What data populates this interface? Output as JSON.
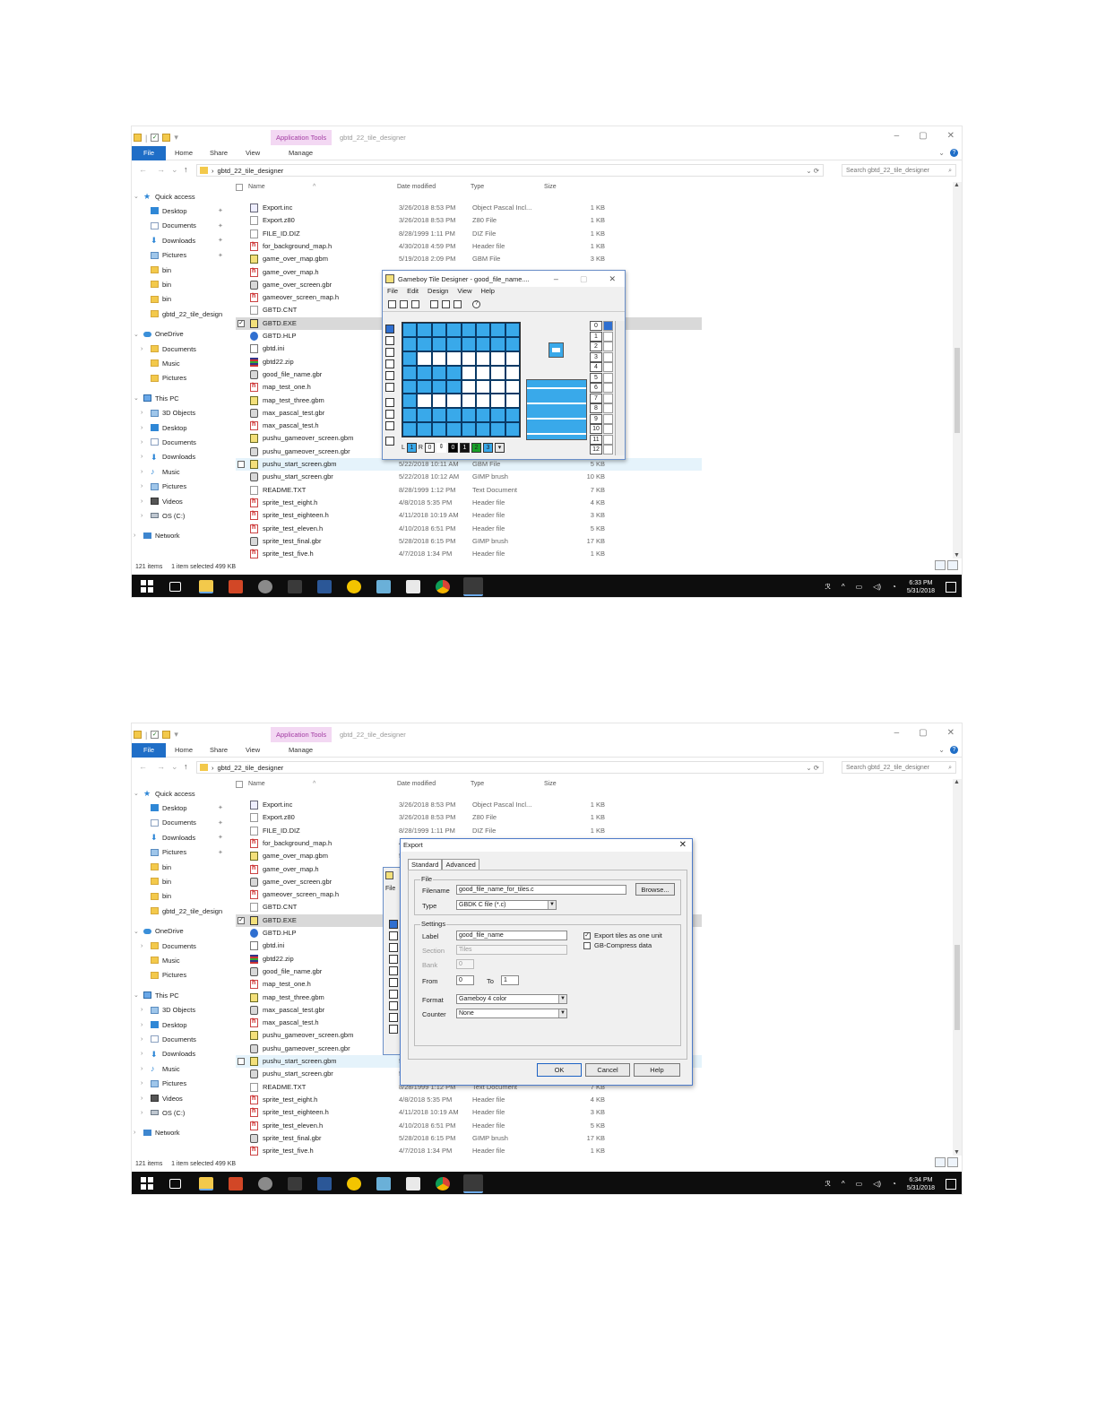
{
  "explorer": {
    "app_tools": "Application Tools",
    "window_title": "gbtd_22_tile_designer",
    "ribbon_tabs": [
      "File",
      "Home",
      "Share",
      "View",
      "Manage"
    ],
    "address": "gbtd_22_tile_designer",
    "search_placeholder": "Search gbtd_22_tile_designer",
    "columns": {
      "name": "Name",
      "date": "Date modified",
      "type": "Type",
      "size": "Size"
    },
    "nav": [
      {
        "label": "Quick access",
        "icon": "star-icon",
        "indent": 0,
        "chev": "⌄",
        "pin": false
      },
      {
        "label": "Desktop",
        "icon": "desktop-icon",
        "indent": 1,
        "chev": "",
        "pin": true
      },
      {
        "label": "Documents",
        "icon": "documents-icon",
        "indent": 1,
        "chev": "",
        "pin": true
      },
      {
        "label": "Downloads",
        "icon": "downloads-icon",
        "indent": 1,
        "chev": "",
        "pin": true
      },
      {
        "label": "Pictures",
        "icon": "pictures-icon",
        "indent": 1,
        "chev": "",
        "pin": true
      },
      {
        "label": "bin",
        "icon": "folder-icon",
        "indent": 1,
        "chev": "",
        "pin": false
      },
      {
        "label": "bin",
        "icon": "folder-icon",
        "indent": 1,
        "chev": "",
        "pin": false
      },
      {
        "label": "bin",
        "icon": "folder-icon",
        "indent": 1,
        "chev": "",
        "pin": false
      },
      {
        "label": "gbtd_22_tile_design",
        "icon": "folder-icon",
        "indent": 1,
        "chev": "",
        "pin": false
      },
      {
        "label": "OneDrive",
        "icon": "cloud-icon",
        "indent": 0,
        "chev": "⌄",
        "pin": false
      },
      {
        "label": "Documents",
        "icon": "folder-icon",
        "indent": 1,
        "chev": "›",
        "pin": false
      },
      {
        "label": "Music",
        "icon": "folder-icon",
        "indent": 1,
        "chev": "",
        "pin": false
      },
      {
        "label": "Pictures",
        "icon": "folder-icon",
        "indent": 1,
        "chev": "",
        "pin": false
      },
      {
        "label": "This PC",
        "icon": "pc-icon",
        "indent": 0,
        "chev": "⌄",
        "pin": false
      },
      {
        "label": "3D Objects",
        "icon": "objects-3d-icon",
        "indent": 1,
        "chev": "›",
        "pin": false
      },
      {
        "label": "Desktop",
        "icon": "desktop-icon",
        "indent": 1,
        "chev": "›",
        "pin": false
      },
      {
        "label": "Documents",
        "icon": "documents-icon",
        "indent": 1,
        "chev": "›",
        "pin": false
      },
      {
        "label": "Downloads",
        "icon": "downloads-icon",
        "indent": 1,
        "chev": "›",
        "pin": false
      },
      {
        "label": "Music",
        "icon": "music-icon",
        "indent": 1,
        "chev": "›",
        "pin": false
      },
      {
        "label": "Pictures",
        "icon": "pictures-icon",
        "indent": 1,
        "chev": "›",
        "pin": false
      },
      {
        "label": "Videos",
        "icon": "videos-icon",
        "indent": 1,
        "chev": "›",
        "pin": false
      },
      {
        "label": "OS (C:)",
        "icon": "drive-icon",
        "indent": 1,
        "chev": "›",
        "pin": false
      },
      {
        "label": "Network",
        "icon": "network-icon",
        "indent": 0,
        "chev": "›",
        "pin": false
      }
    ],
    "files": [
      {
        "name": "Export.inc",
        "date": "3/26/2018 8:53 PM",
        "type": "Object Pascal Incl...",
        "size": "1 KB",
        "icon": "inc"
      },
      {
        "name": "Export.z80",
        "date": "3/26/2018 8:53 PM",
        "type": "Z80 File",
        "size": "1 KB",
        "icon": "txt"
      },
      {
        "name": "FILE_ID.DIZ",
        "date": "8/28/1999 1:11 PM",
        "type": "DIZ File",
        "size": "1 KB",
        "icon": "txt"
      },
      {
        "name": "for_background_map.h",
        "date": "4/30/2018 4:59 PM",
        "type": "Header file",
        "size": "1 KB",
        "icon": "h"
      },
      {
        "name": "game_over_map.gbm",
        "date": "5/19/2018 2:09 PM",
        "type": "GBM File",
        "size": "3 KB",
        "icon": "gbm"
      },
      {
        "name": "game_over_map.h",
        "date": "",
        "type": "",
        "size": "",
        "icon": "h"
      },
      {
        "name": "game_over_screen.gbr",
        "date": "",
        "type": "",
        "size": "",
        "icon": "gbr"
      },
      {
        "name": "gameover_screen_map.h",
        "date": "",
        "type": "",
        "size": "",
        "icon": "h"
      },
      {
        "name": "GBTD.CNT",
        "date": "",
        "type": "",
        "size": "",
        "icon": "txt"
      },
      {
        "name": "GBTD.EXE",
        "date": "",
        "type": "",
        "size": "",
        "icon": "exe",
        "selected": true
      },
      {
        "name": "GBTD.HLP",
        "date": "",
        "type": "",
        "size": "",
        "icon": "hlp"
      },
      {
        "name": "gbtd.ini",
        "date": "",
        "type": "",
        "size": "",
        "icon": "ini"
      },
      {
        "name": "gbtd22.zip",
        "date": "",
        "type": "",
        "size": "",
        "icon": "zip"
      },
      {
        "name": "good_file_name.gbr",
        "date": "",
        "type": "",
        "size": "",
        "icon": "gbr"
      },
      {
        "name": "map_test_one.h",
        "date": "",
        "type": "",
        "size": "",
        "icon": "h"
      },
      {
        "name": "map_test_three.gbm",
        "date": "",
        "type": "",
        "size": "",
        "icon": "gbm"
      },
      {
        "name": "max_pascal_test.gbr",
        "date": "",
        "type": "",
        "size": "",
        "icon": "gbr"
      },
      {
        "name": "max_pascal_test.h",
        "date": "",
        "type": "",
        "size": "",
        "icon": "h"
      },
      {
        "name": "pushu_gameover_screen.gbm",
        "date": "",
        "type": "",
        "size": "",
        "icon": "gbm"
      },
      {
        "name": "pushu_gameover_screen.gbr",
        "date": "",
        "type": "",
        "size": "",
        "icon": "gbr"
      },
      {
        "name": "pushu_start_screen.gbm",
        "date": "5/22/2018 10:11 AM",
        "type": "GBM File",
        "size": "5 KB",
        "icon": "gbm",
        "hover": true
      },
      {
        "name": "pushu_start_screen.gbr",
        "date": "5/22/2018 10:12 AM",
        "type": "GIMP brush",
        "size": "10 KB",
        "icon": "gbr"
      },
      {
        "name": "README.TXT",
        "date": "8/28/1999 1:12 PM",
        "type": "Text Document",
        "size": "7 KB",
        "icon": "txt"
      },
      {
        "name": "sprite_test_eight.h",
        "date": "4/8/2018 5:35 PM",
        "type": "Header file",
        "size": "4 KB",
        "icon": "h"
      },
      {
        "name": "sprite_test_eighteen.h",
        "date": "4/11/2018 10:19 AM",
        "type": "Header file",
        "size": "3 KB",
        "icon": "h"
      },
      {
        "name": "sprite_test_eleven.h",
        "date": "4/10/2018 6:51 PM",
        "type": "Header file",
        "size": "5 KB",
        "icon": "h"
      },
      {
        "name": "sprite_test_final.gbr",
        "date": "5/28/2018 6:15 PM",
        "type": "GIMP brush",
        "size": "17 KB",
        "icon": "gbr"
      },
      {
        "name": "sprite_test_five.h",
        "date": "4/7/2018 1:34 PM",
        "type": "Header file",
        "size": "1 KB",
        "icon": "h"
      }
    ],
    "status_count": "121 items",
    "status_selected": "1 item selected  499 KB"
  },
  "shot1": {
    "clock_time": "6:33 PM",
    "clock_date": "5/31/2018"
  },
  "shot2": {
    "clock_time": "6:34 PM",
    "clock_date": "5/31/2018"
  },
  "gbtd": {
    "title": "Gameboy Tile Designer - good_file_name....",
    "menu": [
      "File",
      "Edit",
      "Design",
      "View",
      "Help"
    ],
    "pixels": [
      [
        1,
        1,
        1,
        1,
        1,
        1,
        1,
        1
      ],
      [
        1,
        1,
        1,
        1,
        1,
        1,
        1,
        1
      ],
      [
        1,
        0,
        0,
        0,
        0,
        0,
        0,
        0
      ],
      [
        1,
        1,
        1,
        1,
        0,
        0,
        0,
        0
      ],
      [
        1,
        1,
        1,
        1,
        0,
        0,
        0,
        0
      ],
      [
        1,
        0,
        0,
        0,
        0,
        0,
        0,
        0
      ],
      [
        1,
        1,
        1,
        1,
        1,
        1,
        1,
        1
      ],
      [
        1,
        1,
        1,
        1,
        1,
        1,
        1,
        1
      ]
    ],
    "tile_numbers": [
      "0",
      "1",
      "2",
      "3",
      "4",
      "5",
      "6",
      "7",
      "8",
      "9",
      "10",
      "11",
      "12"
    ],
    "color_bar": {
      "l": "L",
      "l_val": "1",
      "r": "R",
      "r_val": "0",
      "colors": [
        "0",
        "1",
        "2",
        "3"
      ]
    },
    "accent": "#39a9ea"
  },
  "export": {
    "title": "Export",
    "tabs": [
      "Standard",
      "Advanced"
    ],
    "file_group": "File",
    "filename_label": "Filename",
    "filename_value": "good_file_name_for_tiles.c",
    "browse": "Browse...",
    "type_label": "Type",
    "type_value": "GBDK C file (*.c)",
    "settings_group": "Settings",
    "label_label": "Label",
    "label_value": "good_file_name",
    "section_label": "Section",
    "section_value": "Tiles",
    "bank_label": "Bank",
    "bank_value": "0",
    "from_label": "From",
    "from_value": "0",
    "to_label": "To",
    "to_value": "1",
    "format_label": "Format",
    "format_value": "Gameboy 4 color",
    "counter_label": "Counter",
    "counter_value": "None",
    "export_tiles_one_unit": "Export tiles as one unit",
    "export_tiles_checked": true,
    "gb_compress": "GB-Compress data",
    "gb_compress_checked": false,
    "ok": "OK",
    "cancel": "Cancel",
    "help": "Help"
  }
}
